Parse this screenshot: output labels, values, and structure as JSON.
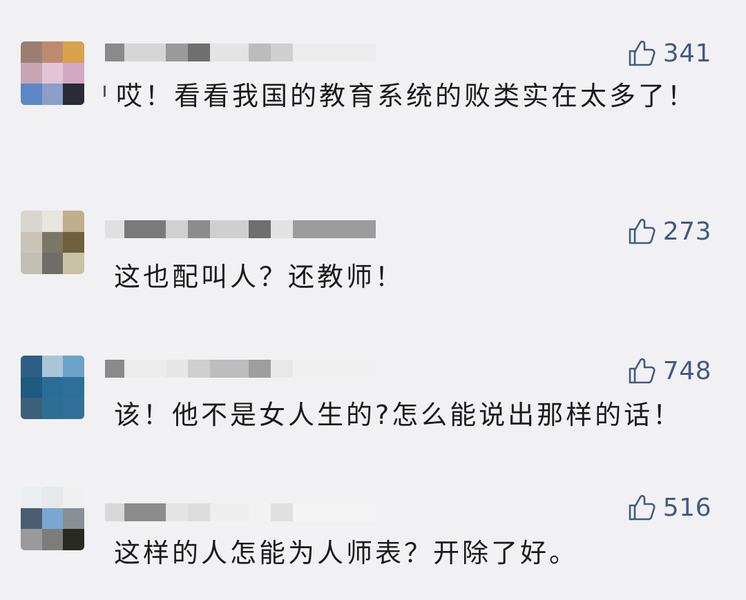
{
  "comments": [
    {
      "text": "哎！看看我国的教育系统的败类实在太多了！",
      "likes": "341",
      "avatar_colors": [
        "#9c7f72",
        "#c08a70",
        "#d9a24c",
        "#c7a5b5",
        "#e3c4d6",
        "#d2a9c4",
        "#5d86c7",
        "#8a9ec7",
        "#2a2b36"
      ],
      "name_blocks": [
        "#8a8a8a",
        "#d6d6d6",
        "#9a9a9a",
        "#6f6f6f",
        "#e4e4e4",
        "#bcbcbc",
        "#cfcfcf",
        "#ececec"
      ]
    },
    {
      "text": "这也配叫人？还教师！",
      "likes": "273",
      "avatar_colors": [
        "#d8d6cf",
        "#e8e5df",
        "#bfae8c",
        "#c9c4b7",
        "#7a7766",
        "#6e5f3e",
        "#c2bfb5",
        "#6e6e66",
        "#c9c1a4"
      ],
      "name_blocks": [
        "#e0e0e0",
        "#7a7a7a",
        "#d0d0d0",
        "#8c8c8c",
        "#cfcfcf",
        "#6e6e6e",
        "#e2e2e2",
        "#9c9c9c"
      ]
    },
    {
      "text": "该！他不是女人生的?怎么能说出那样的话！",
      "likes": "748",
      "avatar_colors": [
        "#2e5f86",
        "#a8c6d8",
        "#6aa2c8",
        "#1f5a80",
        "#2a6e98",
        "#2d6f99",
        "#3c5f7a",
        "#2e6d94",
        "#32709a"
      ],
      "name_blocks": [
        "#8a8a8a",
        "#ececec",
        "#e6e6e6",
        "#cfcfcf",
        "#bdbdbd",
        "#9e9e9e",
        "#e8e8e8",
        "#f0f0f0"
      ]
    },
    {
      "text": "这样的人怎能为人师表？开除了好。",
      "likes": "516",
      "avatar_colors": [
        "#eceff2",
        "#e6e8ea",
        "#f0f0f0",
        "#4a5d72",
        "#7ba6d2",
        "#8a8f96",
        "#9a9a9a",
        "#7c7c7c",
        "#2a2a22"
      ],
      "name_blocks": [
        "#d8d8d8",
        "#8c8c8c",
        "#e4e4e4",
        "#dcdcdc",
        "#eeeeee",
        "#f2f2f2",
        "#e0e0e0",
        "#f4f4f4"
      ]
    }
  ]
}
